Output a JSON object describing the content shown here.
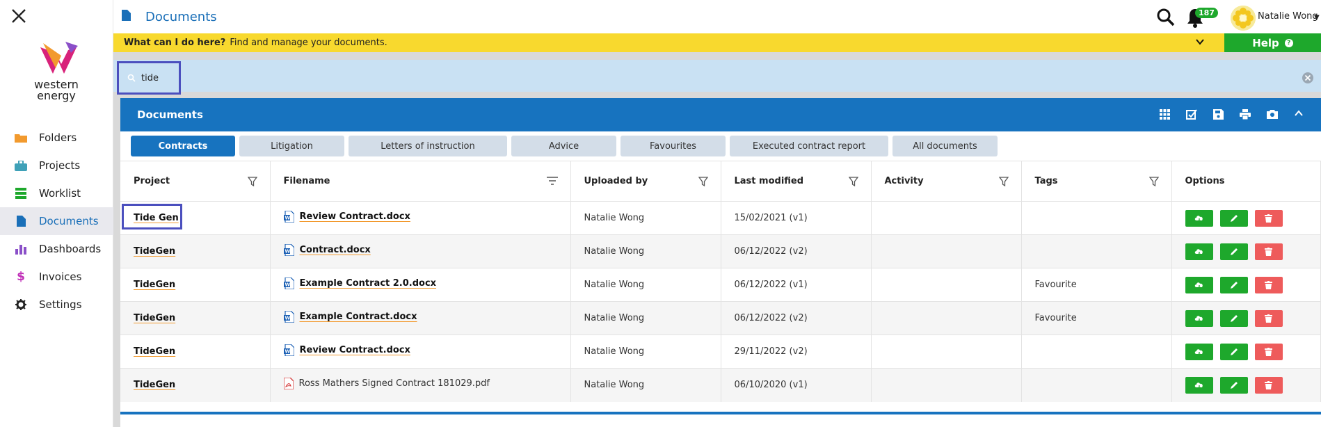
{
  "topbar": {
    "page_title": "Documents",
    "notification_count": "187",
    "user_name": "Natalie Wong"
  },
  "logo": {
    "line1": "western",
    "line2": "energy"
  },
  "sidebar": {
    "items": [
      {
        "label": "Folders",
        "icon": "folder-icon",
        "color": "#f29a2e"
      },
      {
        "label": "Projects",
        "icon": "briefcase-icon",
        "color": "#3fa1b8"
      },
      {
        "label": "Worklist",
        "icon": "worklist-icon",
        "color": "#1ea82c"
      },
      {
        "label": "Documents",
        "icon": "document-icon",
        "color": "#1a6fb8",
        "active": true
      },
      {
        "label": "Dashboards",
        "icon": "bar-chart-icon",
        "color": "#8a4fc8"
      },
      {
        "label": "Invoices",
        "icon": "dollar-icon",
        "color": "#c02fb8"
      },
      {
        "label": "Settings",
        "icon": "gear-icon",
        "color": "#222222"
      }
    ]
  },
  "info_bar": {
    "question": "What can I do here?",
    "answer": "Find and manage your documents.",
    "help_label": "Help"
  },
  "search": {
    "value": "tide"
  },
  "panel": {
    "title": "Documents",
    "tabs": [
      "Contracts",
      "Litigation",
      "Letters of instruction",
      "Advice",
      "Favourites",
      "Executed contract report",
      "All documents"
    ],
    "columns": [
      "Project",
      "Filename",
      "Uploaded by",
      "Last modified",
      "Activity",
      "Tags",
      "Options"
    ],
    "rows": [
      {
        "project": "Tide Gen",
        "filename": "Review Contract.docx",
        "type": "word",
        "uploaded_by": "Natalie Wong",
        "modified": "15/02/2021 (v1)",
        "activity": "",
        "tags": ""
      },
      {
        "project": "TideGen",
        "filename": "Contract.docx",
        "type": "word",
        "uploaded_by": "Natalie Wong",
        "modified": "06/12/2022 (v2)",
        "activity": "",
        "tags": ""
      },
      {
        "project": "TideGen",
        "filename": "Example Contract 2.0.docx",
        "type": "word",
        "uploaded_by": "Natalie Wong",
        "modified": "06/12/2022 (v1)",
        "activity": "",
        "tags": "Favourite"
      },
      {
        "project": "TideGen",
        "filename": "Example Contract.docx",
        "type": "word",
        "uploaded_by": "Natalie Wong",
        "modified": "06/12/2022 (v2)",
        "activity": "",
        "tags": "Favourite"
      },
      {
        "project": "TideGen",
        "filename": "Review Contract.docx",
        "type": "word",
        "uploaded_by": "Natalie Wong",
        "modified": "29/11/2022 (v2)",
        "activity": "",
        "tags": ""
      },
      {
        "project": "TideGen",
        "filename": "Ross Mathers Signed Contract 181029.pdf",
        "type": "pdf",
        "uploaded_by": "Natalie Wong",
        "modified": "06/10/2020 (v1)",
        "activity": "",
        "tags": ""
      }
    ]
  },
  "colors": {
    "accent": "#1773bf",
    "info_bar": "#f8d92e",
    "help": "#1ea82c",
    "search_band": "#c9e1f3",
    "highlight": "#4b4fbe"
  }
}
